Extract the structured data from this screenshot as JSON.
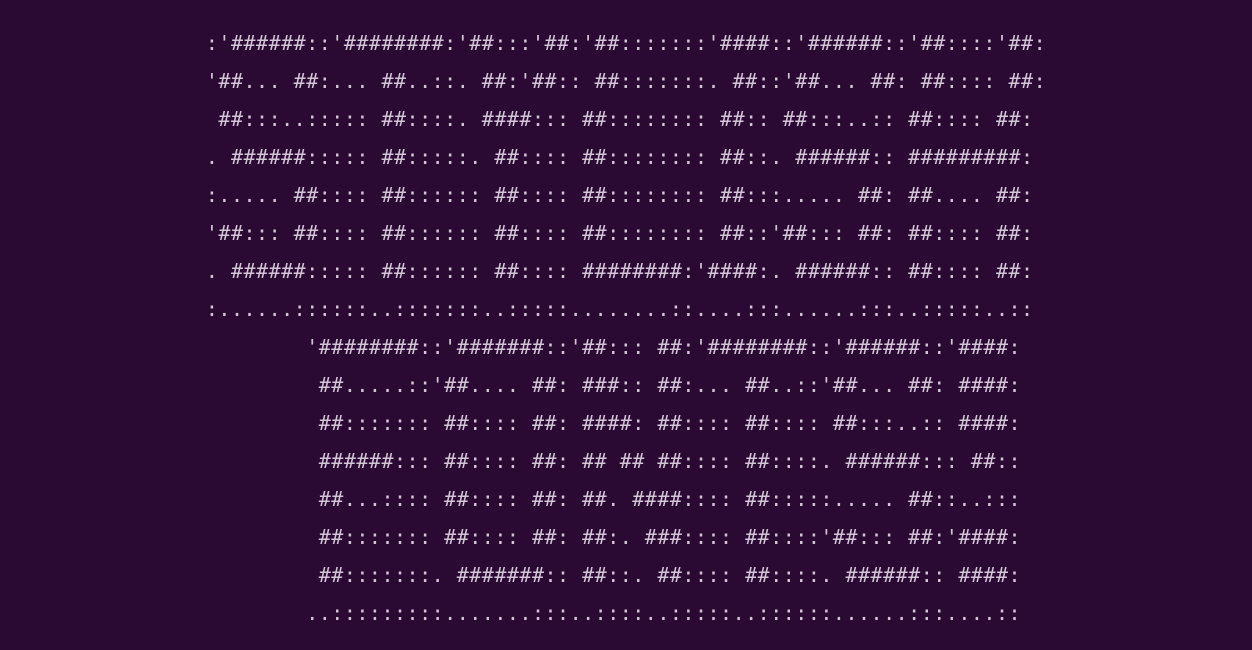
{
  "ascii_art": {
    "text_top": "STYLISH",
    "text_bottom": "FONTS!",
    "font_style": "ansi-shadow",
    "lines": [
      ":'######::'########:'##:::'##:'##:::::::'####::'######::'##::::'##:",
      "'##... ##:... ##..::. ##:'##:: ##:::::::. ##::'##... ##: ##:::: ##:",
      " ##:::..::::: ##::::. ####::: ##:::::::: ##:: ##:::..:: ##:::: ##:",
      ". ######::::: ##:::::. ##:::: ##:::::::: ##::. ######:: #########:",
      ":..... ##:::: ##:::::: ##:::: ##:::::::: ##:::..... ##: ##.... ##:",
      "'##::: ##:::: ##:::::: ##:::: ##:::::::: ##::'##::: ##: ##:::: ##:",
      ". ######::::: ##:::::: ##:::: ########:'####:. ######:: ##:::: ##:",
      ":......::::::..:::::::..:::::........::....:::......:::..:::::..::",
      "        '########::'#######::'##::: ##:'########::'######::'####:",
      "         ##.....::'##.... ##: ###:: ##:... ##..::'##... ##: ####:",
      "         ##::::::: ##:::: ##: ####: ##:::: ##:::: ##:::..:: ####:",
      "         ######::: ##:::: ##: ## ## ##:::: ##::::. ######::: ##::",
      "         ##...:::: ##:::: ##: ##. ####:::: ##:::::..... ##::..:::",
      "         ##::::::: ##:::: ##: ##:. ###:::: ##::::'##::: ##:'####:",
      "         ##:::::::. #######:: ##::. ##:::: ##::::. ######:: ####:",
      "        ..:::::::::.......:::..::::..:::::..::::::......:::....::"
    ]
  },
  "colors": {
    "background": "#2a0a33",
    "foreground": "#d4c4d8"
  }
}
